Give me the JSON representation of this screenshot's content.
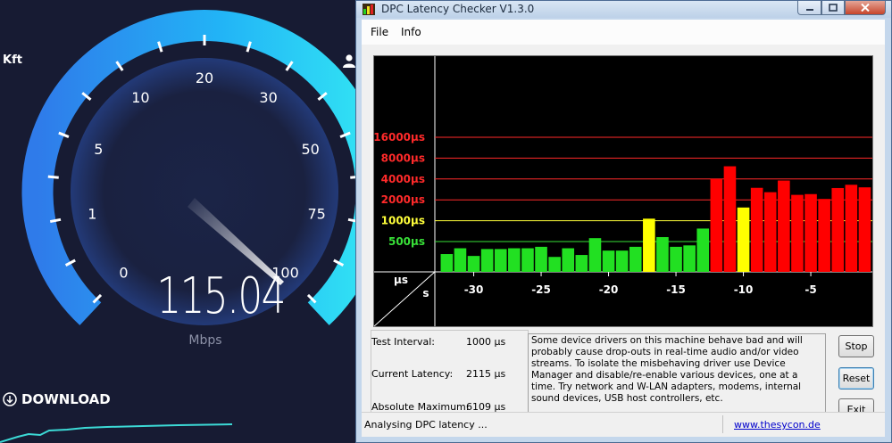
{
  "speedtest": {
    "corner_label": "Kft",
    "gauge_labels": [
      "0",
      "1",
      "5",
      "10",
      "20",
      "30",
      "50",
      "75",
      "100"
    ],
    "speed_value": "115.04",
    "speed_unit": "Mbps",
    "download_label": "DOWNLOAD",
    "colors": {
      "background": "#171b33",
      "arc_start": "#2f7bea",
      "arc_end": "#32e4f4"
    }
  },
  "dpc_window": {
    "title": "DPC Latency Checker V1.3.0",
    "menu": [
      "File",
      "Info"
    ],
    "info": {
      "test_interval_label": "Test Interval:",
      "test_interval_value": "1000 µs",
      "current_latency_label": "Current Latency:",
      "current_latency_value": "2115 µs",
      "absolute_max_label": "Absolute Maximum:",
      "absolute_max_value": "6109 µs"
    },
    "description": "Some device drivers on this machine behave bad and will probably cause drop-outs in real-time audio and/or video streams. To isolate the misbehaving driver use Device Manager and disable/re-enable various devices, one at a time. Try network and W-LAN adapters, modems, internal sound devices, USB host controllers, etc.",
    "buttons": {
      "stop": "Stop",
      "reset": "Reset",
      "exit": "Exit"
    },
    "status": {
      "text": "Analysing DPC latency ...",
      "link": "www.thesycon.de"
    }
  },
  "chart_data": {
    "type": "bar",
    "corner_label_top": "µs",
    "corner_label_bottom": "s",
    "y_tick_labels": [
      {
        "label": "16000µs",
        "value": 16000,
        "color": "#ff2a2a"
      },
      {
        "label": "8000µs",
        "value": 8000,
        "color": "#ff2a2a"
      },
      {
        "label": "4000µs",
        "value": 4000,
        "color": "#ff2a2a"
      },
      {
        "label": "2000µs",
        "value": 2000,
        "color": "#ff2a2a"
      },
      {
        "label": "1000µs",
        "value": 1000,
        "color": "#ffff3a"
      },
      {
        "label": "500µs",
        "value": 500,
        "color": "#38e038"
      }
    ],
    "x_tick_labels": [
      "-30",
      "-25",
      "-20",
      "-15",
      "-10",
      "-5"
    ],
    "x_ticks": [
      -30,
      -25,
      -20,
      -15,
      -10,
      -5
    ],
    "xlim": [
      -33,
      0
    ],
    "scale": "log2",
    "ylim": [
      250,
      32000
    ],
    "bar_colors": {
      "green": "#22e022",
      "yellow": "#ffff00",
      "red": "#ff0000"
    },
    "x": [
      -32,
      -31,
      -30,
      -29,
      -28,
      -27,
      -26,
      -25,
      -24,
      -23,
      -22,
      -21,
      -20,
      -19,
      -18,
      -17,
      -16,
      -15,
      -14,
      -13,
      -12,
      -11,
      -10,
      -9,
      -8,
      -7,
      -6,
      -5,
      -4,
      -3,
      -2,
      -1
    ],
    "values": [
      330,
      400,
      310,
      390,
      390,
      400,
      400,
      420,
      300,
      400,
      320,
      560,
      370,
      370,
      420,
      1070,
      580,
      420,
      440,
      770,
      4000,
      6100,
      1550,
      2980,
      2580,
      3800,
      2360,
      2420,
      2060,
      2960,
      3300,
      3030
    ],
    "colors": [
      "green",
      "green",
      "green",
      "green",
      "green",
      "green",
      "green",
      "green",
      "green",
      "green",
      "green",
      "green",
      "green",
      "green",
      "green",
      "yellow",
      "green",
      "green",
      "green",
      "green",
      "red",
      "red",
      "yellow",
      "red",
      "red",
      "red",
      "red",
      "red",
      "red",
      "red",
      "red",
      "red"
    ]
  }
}
